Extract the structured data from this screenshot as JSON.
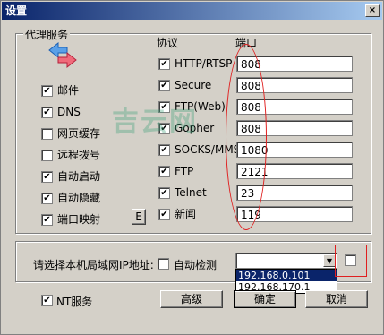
{
  "window": {
    "title": "设置",
    "close_label": "×"
  },
  "proxy_group": {
    "title": "代理服务"
  },
  "left_services": [
    {
      "label": "邮件",
      "checked": true
    },
    {
      "label": "DNS",
      "checked": true
    },
    {
      "label": "网页缓存",
      "checked": false
    },
    {
      "label": "远程拨号",
      "checked": false
    },
    {
      "label": "自动启动",
      "checked": true
    },
    {
      "label": "自动隐藏",
      "checked": true
    },
    {
      "label": "端口映射",
      "checked": true
    }
  ],
  "e_button_label": "E",
  "protocol_header": "协议",
  "port_header": "端口",
  "protocols": [
    {
      "label": "HTTP/RTSP",
      "checked": true,
      "port": "808"
    },
    {
      "label": "Secure",
      "checked": true,
      "port": "808"
    },
    {
      "label": "FTP(Web)",
      "checked": true,
      "port": "808"
    },
    {
      "label": "Gopher",
      "checked": true,
      "port": "808"
    },
    {
      "label": "SOCKS/MMS",
      "checked": true,
      "port": "1080"
    },
    {
      "label": "FTP",
      "checked": true,
      "port": "2121"
    },
    {
      "label": "Telnet",
      "checked": true,
      "port": "23"
    },
    {
      "label": "新闻",
      "checked": true,
      "port": "119"
    }
  ],
  "watermark": "吉云网",
  "lan": {
    "label": "请选择本机局域网IP地址:",
    "auto_detect_label": "自动检测",
    "auto_detect_checked": false,
    "selected_value": "",
    "options": [
      "192.168.0.101",
      "192.168.170.1"
    ],
    "highlighted_index": 0,
    "extra_checkbox_checked": false
  },
  "nt_service": {
    "label": "NT服务",
    "checked": true
  },
  "buttons": {
    "advanced": "高级",
    "ok": "确定",
    "cancel": "取消"
  },
  "check_mark": "✔",
  "arrow_down": "▼"
}
